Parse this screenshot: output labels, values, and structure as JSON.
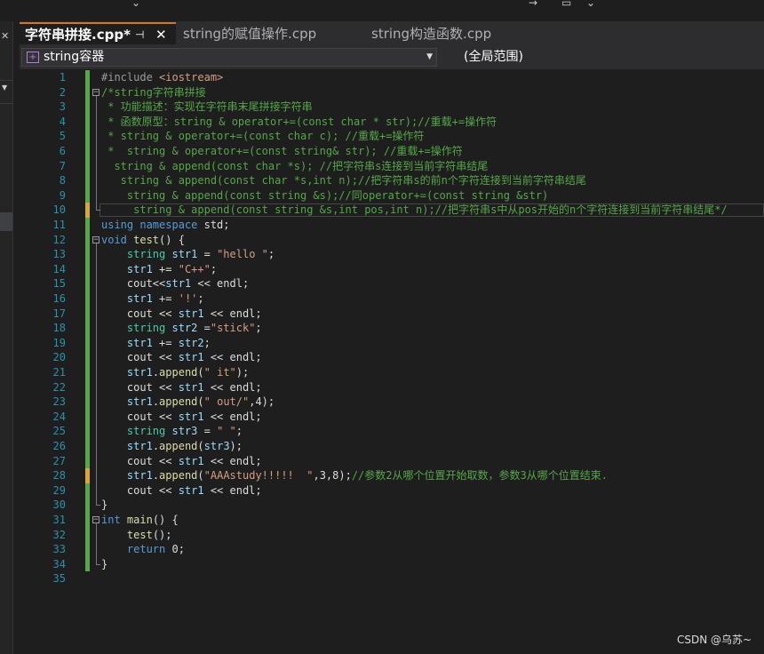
{
  "window": {
    "tabs": [
      {
        "label": "字符串拼接.cpp*",
        "active": true,
        "pin_icon": "pin-icon",
        "close_icon": "close-icon"
      },
      {
        "label": "string的赋值操作.cpp",
        "active": false
      },
      {
        "label": "string构造函数.cpp",
        "active": false
      }
    ]
  },
  "navbar": {
    "class_selector": "string容器",
    "scope_selector": "(全局范围)"
  },
  "editor": {
    "lines": [
      {
        "n": "1",
        "t": [
          {
            "c": "pp",
            "s": "#include "
          },
          {
            "c": "str",
            "s": "<iostream>"
          }
        ]
      },
      {
        "n": "2",
        "t": [
          {
            "c": "cm",
            "s": "/*string字符串拼接"
          }
        ]
      },
      {
        "n": "3",
        "t": [
          {
            "c": "cm",
            "s": " * 功能描述：实现在字符串末尾拼接字符串"
          }
        ]
      },
      {
        "n": "4",
        "t": [
          {
            "c": "cm",
            "s": " * 函数原型：string & operator+=(const char * str);//重载+=操作符"
          }
        ]
      },
      {
        "n": "5",
        "t": [
          {
            "c": "cm",
            "s": " * string & operator+=(const char c); //重载+=操作符"
          }
        ]
      },
      {
        "n": "6",
        "t": [
          {
            "c": "cm",
            "s": " *  string & operator+=(const string& str); //重载+=操作符"
          }
        ]
      },
      {
        "n": "7",
        "t": [
          {
            "c": "cm",
            "s": "  string & append(const char *s); //把字符串s连接到当前字符串结尾"
          }
        ]
      },
      {
        "n": "8",
        "t": [
          {
            "c": "cm",
            "s": "   string & append(const char *s,int n);//把字符串s的前n个字符连接到当前字符串结尾"
          }
        ]
      },
      {
        "n": "9",
        "t": [
          {
            "c": "cm",
            "s": "    string & append(const string &s);//同operator+=(const string &str)"
          }
        ]
      },
      {
        "n": "10",
        "t": [
          {
            "c": "cm",
            "s": "     string & append(const string &s,int pos,int n);//把字符串s中从pos开始的n个字符连接到当前字符串结尾*/"
          }
        ]
      },
      {
        "n": "11",
        "t": [
          {
            "c": "kw",
            "s": "using namespace "
          },
          {
            "c": "pl",
            "s": "std;"
          }
        ]
      },
      {
        "n": "12",
        "t": [
          {
            "c": "kw",
            "s": "void "
          },
          {
            "c": "fn",
            "s": "test"
          },
          {
            "c": "pl",
            "s": "() {"
          }
        ]
      },
      {
        "n": "13",
        "t": [
          {
            "c": "pl",
            "s": "    "
          },
          {
            "c": "ty",
            "s": "string "
          },
          {
            "c": "var",
            "s": "str1"
          },
          {
            "c": "pl",
            "s": " = "
          },
          {
            "c": "str",
            "s": "\"hello \""
          },
          {
            "c": "pl",
            "s": ";"
          }
        ]
      },
      {
        "n": "14",
        "t": [
          {
            "c": "pl",
            "s": "    "
          },
          {
            "c": "var",
            "s": "str1"
          },
          {
            "c": "pl",
            "s": " += "
          },
          {
            "c": "str",
            "s": "\"C++\""
          },
          {
            "c": "pl",
            "s": ";"
          }
        ]
      },
      {
        "n": "15",
        "t": [
          {
            "c": "pl",
            "s": "    cout<<"
          },
          {
            "c": "var",
            "s": "str1"
          },
          {
            "c": "pl",
            "s": " << endl;"
          }
        ]
      },
      {
        "n": "16",
        "t": [
          {
            "c": "pl",
            "s": "    "
          },
          {
            "c": "var",
            "s": "str1"
          },
          {
            "c": "pl",
            "s": " += "
          },
          {
            "c": "str",
            "s": "'!'"
          },
          {
            "c": "pl",
            "s": ";"
          }
        ]
      },
      {
        "n": "17",
        "t": [
          {
            "c": "pl",
            "s": "    cout << "
          },
          {
            "c": "var",
            "s": "str1"
          },
          {
            "c": "pl",
            "s": " << endl;"
          }
        ]
      },
      {
        "n": "18",
        "t": [
          {
            "c": "pl",
            "s": "    "
          },
          {
            "c": "ty",
            "s": "string "
          },
          {
            "c": "var",
            "s": "str2"
          },
          {
            "c": "pl",
            "s": " ="
          },
          {
            "c": "str",
            "s": "\"stick\""
          },
          {
            "c": "pl",
            "s": ";"
          }
        ]
      },
      {
        "n": "19",
        "t": [
          {
            "c": "pl",
            "s": "    "
          },
          {
            "c": "var",
            "s": "str1"
          },
          {
            "c": "pl",
            "s": " += "
          },
          {
            "c": "var",
            "s": "str2"
          },
          {
            "c": "pl",
            "s": ";"
          }
        ]
      },
      {
        "n": "20",
        "t": [
          {
            "c": "pl",
            "s": "    cout << "
          },
          {
            "c": "var",
            "s": "str1"
          },
          {
            "c": "pl",
            "s": " << endl;"
          }
        ]
      },
      {
        "n": "21",
        "t": [
          {
            "c": "pl",
            "s": "    "
          },
          {
            "c": "var",
            "s": "str1"
          },
          {
            "c": "pl",
            "s": "."
          },
          {
            "c": "fn",
            "s": "append"
          },
          {
            "c": "pl",
            "s": "("
          },
          {
            "c": "str",
            "s": "\" it\""
          },
          {
            "c": "pl",
            "s": ");"
          }
        ]
      },
      {
        "n": "22",
        "t": [
          {
            "c": "pl",
            "s": "    cout << "
          },
          {
            "c": "var",
            "s": "str1"
          },
          {
            "c": "pl",
            "s": " << endl;"
          }
        ]
      },
      {
        "n": "23",
        "t": [
          {
            "c": "pl",
            "s": "    "
          },
          {
            "c": "var",
            "s": "str1"
          },
          {
            "c": "pl",
            "s": "."
          },
          {
            "c": "fn",
            "s": "append"
          },
          {
            "c": "pl",
            "s": "("
          },
          {
            "c": "str",
            "s": "\" out/\""
          },
          {
            "c": "pl",
            "s": ",4);"
          }
        ]
      },
      {
        "n": "24",
        "t": [
          {
            "c": "pl",
            "s": "    cout << "
          },
          {
            "c": "var",
            "s": "str1"
          },
          {
            "c": "pl",
            "s": " << endl;"
          }
        ]
      },
      {
        "n": "25",
        "t": [
          {
            "c": "pl",
            "s": "    "
          },
          {
            "c": "ty",
            "s": "string "
          },
          {
            "c": "var",
            "s": "str3"
          },
          {
            "c": "pl",
            "s": " = "
          },
          {
            "c": "str",
            "s": "\" \""
          },
          {
            "c": "pl",
            "s": ";"
          }
        ]
      },
      {
        "n": "26",
        "t": [
          {
            "c": "pl",
            "s": "    "
          },
          {
            "c": "var",
            "s": "str1"
          },
          {
            "c": "pl",
            "s": "."
          },
          {
            "c": "fn",
            "s": "append"
          },
          {
            "c": "pl",
            "s": "("
          },
          {
            "c": "var",
            "s": "str3"
          },
          {
            "c": "pl",
            "s": ");"
          }
        ]
      },
      {
        "n": "27",
        "t": [
          {
            "c": "pl",
            "s": "    cout << "
          },
          {
            "c": "var",
            "s": "str1"
          },
          {
            "c": "pl",
            "s": " << endl;"
          }
        ]
      },
      {
        "n": "28",
        "t": [
          {
            "c": "pl",
            "s": "    "
          },
          {
            "c": "var",
            "s": "str1"
          },
          {
            "c": "pl",
            "s": "."
          },
          {
            "c": "fn",
            "s": "append"
          },
          {
            "c": "pl",
            "s": "("
          },
          {
            "c": "str",
            "s": "\"AAAstudy!!!!!  \""
          },
          {
            "c": "pl",
            "s": ",3,8);"
          },
          {
            "c": "cm",
            "s": "//参数2从哪个位置开始取数，参数3从哪个位置结束."
          }
        ]
      },
      {
        "n": "29",
        "t": [
          {
            "c": "pl",
            "s": "    cout << "
          },
          {
            "c": "var",
            "s": "str1"
          },
          {
            "c": "pl",
            "s": " << endl;"
          }
        ]
      },
      {
        "n": "30",
        "t": [
          {
            "c": "pl",
            "s": "}"
          }
        ]
      },
      {
        "n": "31",
        "t": [
          {
            "c": "kw",
            "s": "int "
          },
          {
            "c": "fn",
            "s": "main"
          },
          {
            "c": "pl",
            "s": "() {"
          }
        ]
      },
      {
        "n": "32",
        "t": [
          {
            "c": "pl",
            "s": "    "
          },
          {
            "c": "fn",
            "s": "test"
          },
          {
            "c": "pl",
            "s": "();"
          }
        ]
      },
      {
        "n": "33",
        "t": [
          {
            "c": "pl",
            "s": "    "
          },
          {
            "c": "kw",
            "s": "return "
          },
          {
            "c": "pl",
            "s": "0;"
          }
        ]
      },
      {
        "n": "34",
        "t": [
          {
            "c": "pl",
            "s": "}"
          }
        ]
      },
      {
        "n": "35",
        "t": []
      }
    ],
    "modified_marker_lines": [
      "10",
      "28"
    ]
  },
  "colors": {
    "keyword": "#569cd6",
    "type": "#4ec9b0",
    "string": "#d69d85",
    "comment": "#57a64a",
    "preprocessor": "#9b9b9b",
    "function": "#dcdcaa",
    "variable": "#9cdcfe",
    "line_number": "#2b91af",
    "saved_change": "#57a64a",
    "unsaved_change": "#d7a641"
  },
  "watermark": "CSDN @乌苏~"
}
